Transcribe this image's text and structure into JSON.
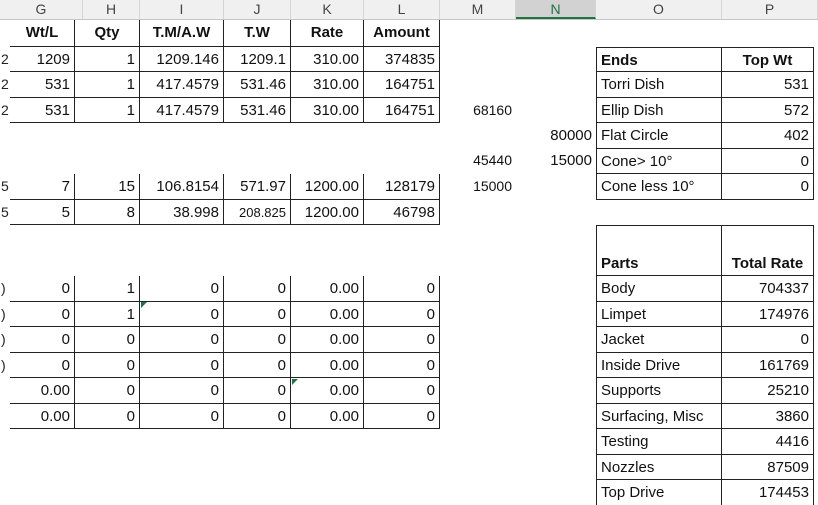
{
  "column_headers": [
    "G",
    "H",
    "I",
    "J",
    "K",
    "L",
    "M",
    "N",
    "O",
    "P"
  ],
  "main_table": {
    "headers": [
      "Wt/L",
      "Qty",
      "T.M/A.W",
      "T.W",
      "Rate",
      "Amount"
    ],
    "rows": [
      [
        "1209",
        "1",
        "1209.146",
        "1209.1",
        "310.00",
        "374835"
      ],
      [
        "531",
        "1",
        "417.4579",
        "531.46",
        "310.00",
        "164751"
      ],
      [
        "531",
        "1",
        "417.4579",
        "531.46",
        "310.00",
        "164751"
      ],
      [
        "7",
        "15",
        "106.8154",
        "571.97",
        "1200.00",
        "128179"
      ],
      [
        "5",
        "8",
        "38.998",
        "208.825",
        "1200.00",
        "46798"
      ],
      [
        "0",
        "1",
        "0",
        "0",
        "0.00",
        "0"
      ],
      [
        "0",
        "1",
        "0",
        "0",
        "0.00",
        "0"
      ],
      [
        "0",
        "0",
        "0",
        "0",
        "0.00",
        "0"
      ],
      [
        "0",
        "0",
        "0",
        "0",
        "0.00",
        "0"
      ],
      [
        "0.00",
        "0",
        "0",
        "0",
        "0.00",
        "0"
      ],
      [
        "0.00",
        "0",
        "0",
        "0",
        "0.00",
        "0"
      ]
    ]
  },
  "col_m_values": [
    "68160",
    "45440",
    "15000"
  ],
  "col_n_values": [
    "80000",
    "15000"
  ],
  "ends_table": {
    "headers": [
      "Ends",
      "Top Wt"
    ],
    "rows": [
      [
        "Torri Dish",
        "531"
      ],
      [
        "Ellip Dish",
        "572"
      ],
      [
        "Flat Circle",
        "402"
      ],
      [
        "Cone> 10°",
        "0"
      ],
      [
        "Cone less 10°",
        "0"
      ]
    ]
  },
  "parts_table": {
    "headers": [
      "Parts",
      "Total Rate"
    ],
    "rows": [
      [
        "Body",
        "704337"
      ],
      [
        "Limpet",
        "174976"
      ],
      [
        "Jacket",
        "0"
      ],
      [
        "Inside Drive",
        "161769"
      ],
      [
        "Supports",
        "25210"
      ],
      [
        "Surfacing, Misc",
        "3860"
      ],
      [
        "Testing",
        "4416"
      ],
      [
        "Nozzles",
        "87509"
      ],
      [
        "Top Drive",
        "174453"
      ]
    ]
  },
  "row_edge_fragments": [
    "2",
    "2",
    "2",
    "5",
    "5",
    ")",
    ")",
    ")",
    ")"
  ],
  "colors": {
    "header_bg": "#f0f0f0",
    "selected_header": "#d2d2d2",
    "excel_green": "#217346",
    "grid": "#222222"
  }
}
